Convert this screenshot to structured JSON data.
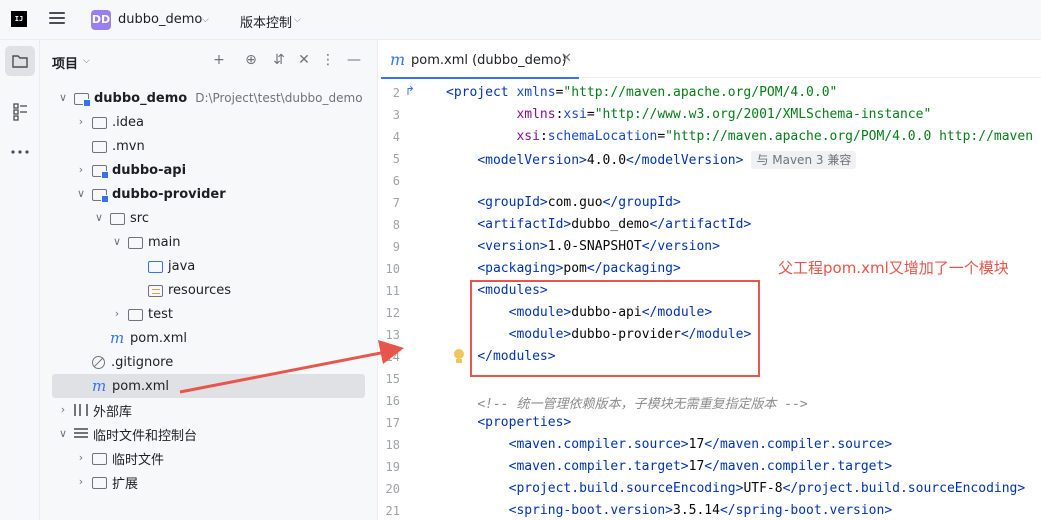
{
  "topbar": {
    "logo_text": "IJ",
    "project_badge": "DD",
    "project_name": "dubbo_demo",
    "vcs_label": "版本控制"
  },
  "panel": {
    "title": "项目",
    "tree": [
      {
        "label": "dubbo_demo",
        "hint": "D:\\Project\\test\\dubbo_demo"
      },
      {
        "label": ".idea"
      },
      {
        "label": ".mvn"
      },
      {
        "label": "dubbo-api"
      },
      {
        "label": "dubbo-provider"
      },
      {
        "label": "src"
      },
      {
        "label": "main"
      },
      {
        "label": "java"
      },
      {
        "label": "resources"
      },
      {
        "label": "test"
      },
      {
        "label": "pom.xml"
      },
      {
        "label": ".gitignore"
      },
      {
        "label": "pom.xml"
      },
      {
        "label": "外部库"
      },
      {
        "label": "临时文件和控制台"
      },
      {
        "label": "临时文件"
      },
      {
        "label": "扩展"
      }
    ]
  },
  "editor": {
    "tab_label": "pom.xml (dubbo_demo)",
    "maven_hint": "与 Maven 3 兼容",
    "line_numbers": [
      "2",
      "3",
      "4",
      "5",
      "6",
      "7",
      "8",
      "9",
      "10",
      "11",
      "12",
      "13",
      "14",
      "15",
      "16",
      "17",
      "18",
      "19",
      "20",
      "21"
    ],
    "lines": {
      "l2_url": "\"http://maven.apache.org/POM/4.0.0\"",
      "l3_url": "\"http://www.w3.org/2001/XMLSchema-instance\"",
      "l4_url": "\"http://maven.apache.org/POM/4.0.0 http://maven",
      "l5_val": "4.0.0",
      "l7_val": "com.guo",
      "l8_val": "dubbo_demo",
      "l9_val": "1.0-SNAPSHOT",
      "l10_val": "pom",
      "l12_val": "dubbo-api",
      "l13_val": "dubbo-provider",
      "l16_comment": "<!-- 统一管理依赖版本，子模块无需重复指定版本 -->",
      "l18_val": "17",
      "l19_val": "17",
      "l20_val": "UTF-8",
      "l21_val": "3.5.14"
    }
  },
  "annotation": {
    "text": "父工程pom.xml又增加了一个模块",
    "color": "#e8554a"
  },
  "colors": {
    "accent": "#3574f0",
    "tag": "#0033b3",
    "attr_value": "#067d17"
  }
}
